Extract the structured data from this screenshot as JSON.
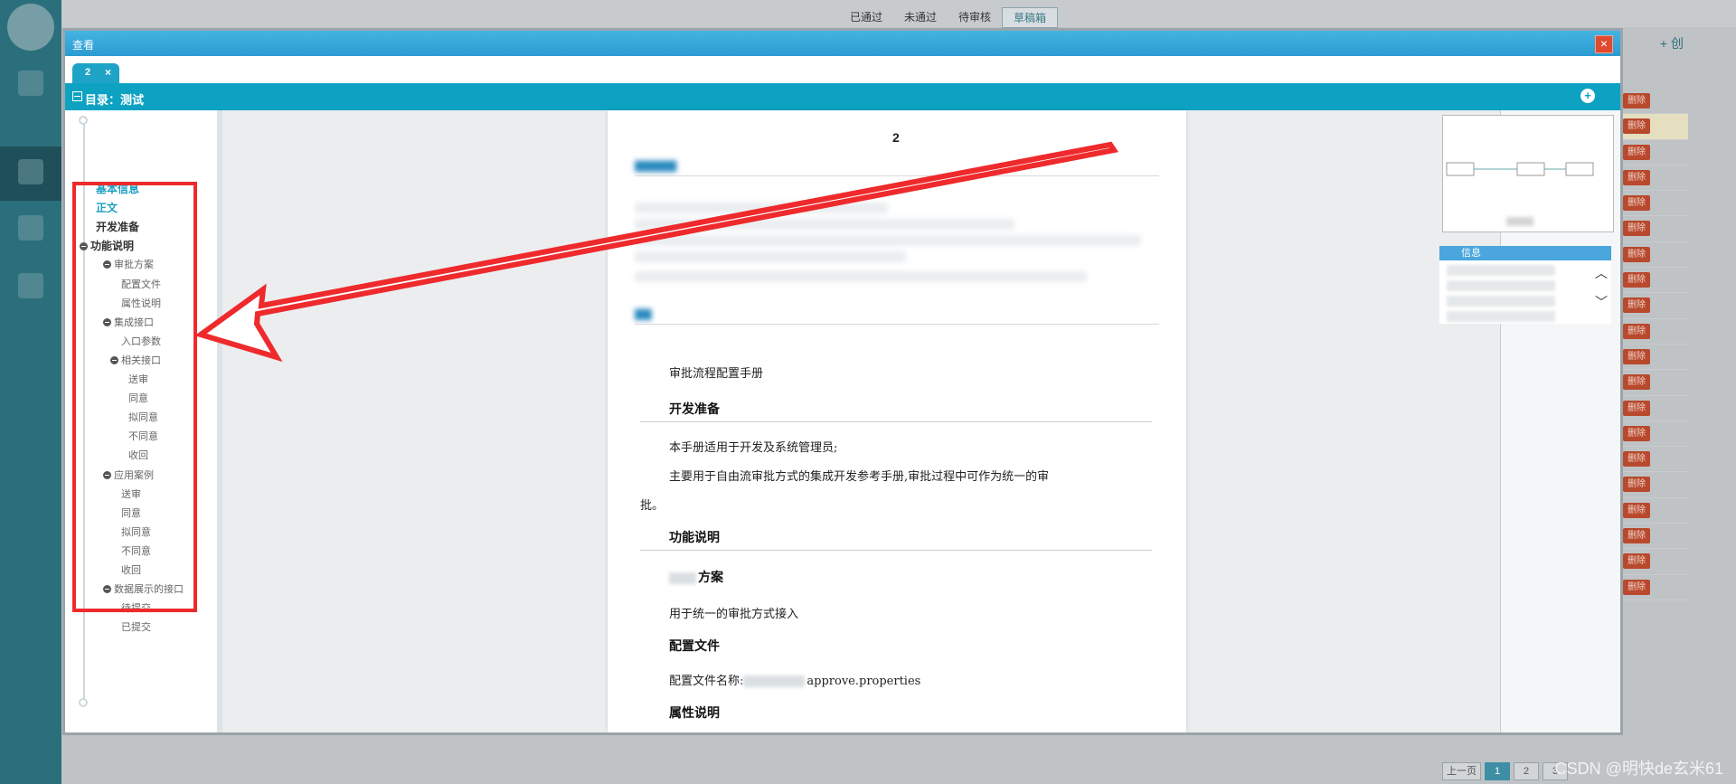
{
  "background": {
    "status_tabs": [
      "已通过",
      "未通过",
      "待审核",
      "草稿箱"
    ],
    "active_status_tab": 3,
    "create_label": "+ 创",
    "delete_label": "删除",
    "delete_rows": 20,
    "pager": [
      "上一页",
      "1",
      "2",
      "3"
    ],
    "current_page": "1",
    "watermark": "CSDN @明快de玄米61"
  },
  "modal": {
    "title": "查看",
    "close_symbol": "×",
    "doc_tab": {
      "label": "2",
      "close": "×"
    },
    "toc_header": "目录：测试",
    "expand_symbol": "+"
  },
  "toc": [
    {
      "label": "基本信息",
      "level": 0,
      "link": true
    },
    {
      "label": "正文",
      "level": 0,
      "link": true
    },
    {
      "label": "开发准备",
      "level": 0,
      "bold": true
    },
    {
      "label": "功能说明",
      "level": 0,
      "bold": true,
      "bullet": true
    },
    {
      "label": "审批方案",
      "level": 1,
      "bullet": true
    },
    {
      "label": "配置文件",
      "level": 2
    },
    {
      "label": "属性说明",
      "level": 2
    },
    {
      "label": "集成接口",
      "level": 1,
      "bullet": true
    },
    {
      "label": "入口参数",
      "level": 2
    },
    {
      "label": "相关接口",
      "level": 2,
      "bullet": true
    },
    {
      "label": "送审",
      "level": 3
    },
    {
      "label": "同意",
      "level": 3
    },
    {
      "label": "拟同意",
      "level": 3
    },
    {
      "label": "不同意",
      "level": 3
    },
    {
      "label": "收回",
      "level": 3
    },
    {
      "label": "应用案例",
      "level": 1,
      "bullet": true
    },
    {
      "label": "送审",
      "level": 2
    },
    {
      "label": "同意",
      "level": 2
    },
    {
      "label": "拟同意",
      "level": 2
    },
    {
      "label": "不同意",
      "level": 2
    },
    {
      "label": "收回",
      "level": 2
    },
    {
      "label": "数据展示的接口",
      "level": 1,
      "bullet": true
    },
    {
      "label": "待提交",
      "level": 2
    },
    {
      "label": "已提交",
      "level": 2
    }
  ],
  "document": {
    "page_number": "2",
    "body_title": "审批流程配置手册",
    "h_prepare": "开发准备",
    "p_prepare_1": "本手册适用于开发及系统管理员;",
    "p_prepare_2": "主要用于自由流审批方式的集成开发参考手册,审批过程中可作为统一的审",
    "p_prepare_3": "批。",
    "h_function": "功能说明",
    "h_scheme": "方案",
    "p_scheme": "用于统一的审批方式接入",
    "h_config": "配置文件",
    "p_config_prefix": "配置文件名称:",
    "p_config_file": "approve.properties",
    "h_attr": "属性说明"
  },
  "right_panel": {
    "info_title": "信息"
  },
  "colors": {
    "accent": "#0ea2c2",
    "titlebar": "#2c9bd2",
    "annotation": "#ee2a2d",
    "delete": "#b8492d"
  }
}
